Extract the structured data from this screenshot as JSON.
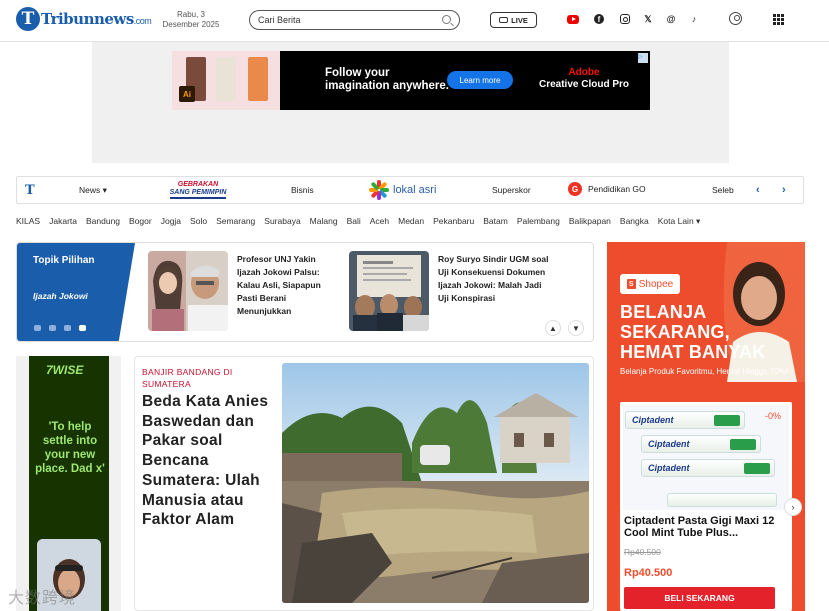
{
  "header": {
    "logo_text": "Tribunnews",
    "logo_domain": ".com",
    "date_line1": "Rabu, 3",
    "date_line2": "Desember 2025",
    "search_placeholder": "Cari Berita",
    "live_label": "LIVE",
    "social_icons": [
      "youtube-icon",
      "facebook-icon",
      "instagram-icon",
      "x-icon",
      "threads-icon",
      "tiktok-icon"
    ]
  },
  "ad_top": {
    "headline_line1": "Follow your",
    "headline_line2": "imagination anywhere.",
    "cta": "Learn more",
    "brand_line1": "Adobe",
    "brand_line2": "Creative Cloud Pro",
    "app_badge": "Ai"
  },
  "nav": {
    "logo_letter": "T",
    "items": [
      "News",
      "Bisnis",
      "Superskor",
      "Pendidikan GO",
      "Seleb"
    ],
    "gebrakan_line1": "GEBRAKAN",
    "gebrakan_line2": "SANG PEMIMPIN",
    "lokal": "lokal asri",
    "pgo_badge": "G"
  },
  "cities": [
    "KILAS",
    "Jakarta",
    "Bandung",
    "Bogor",
    "Jogja",
    "Solo",
    "Semarang",
    "Surabaya",
    "Malang",
    "Bali",
    "Aceh",
    "Medan",
    "Pekanbaru",
    "Batam",
    "Palembang",
    "Balikpapan",
    "Bangka",
    "Kota Lain"
  ],
  "topik": {
    "title": "Topik Pilihan",
    "subtitle": "Ijazah Jokowi",
    "stories": [
      {
        "text": "Profesor UNJ Yakin Ijazah Jokowi Palsu: Kalau Asli, Siapapun Pasti Berani Menunjukkan"
      },
      {
        "text": "Roy Suryo Sindir UGM soal Uji Konsekuensi Dokumen Ijazah Jokowi: Malah Jadi Uji Konspirasi"
      }
    ]
  },
  "shopee": {
    "logo": "Shopee",
    "headline_line1": "BELANJA",
    "headline_line2": "SEKARANG,",
    "headline_line3": "HEMAT BANYAK",
    "sub": "Belanja Produk Favoritmu, Hemat Hingga 70%!",
    "discount": "-0%",
    "tube_brand": "Ciptadent",
    "product_name": "Ciptadent Pasta Gigi Maxi 12 Cool Mint Tube Plus...",
    "old_price": "Rp40.500",
    "new_price": "Rp40.500",
    "buy_label": "BELI SEKARANG"
  },
  "wise": {
    "logo": "7WISE",
    "quote": "'To help settle into your new place. Dad x'"
  },
  "main": {
    "kicker": "BANJIR BANDANG DI SUMATERA",
    "headline": "Beda Kata Anies Baswedan dan Pakar soal Bencana Sumatera: Ulah Manusia atau Faktor Alam"
  },
  "watermark": "大数跨境"
}
